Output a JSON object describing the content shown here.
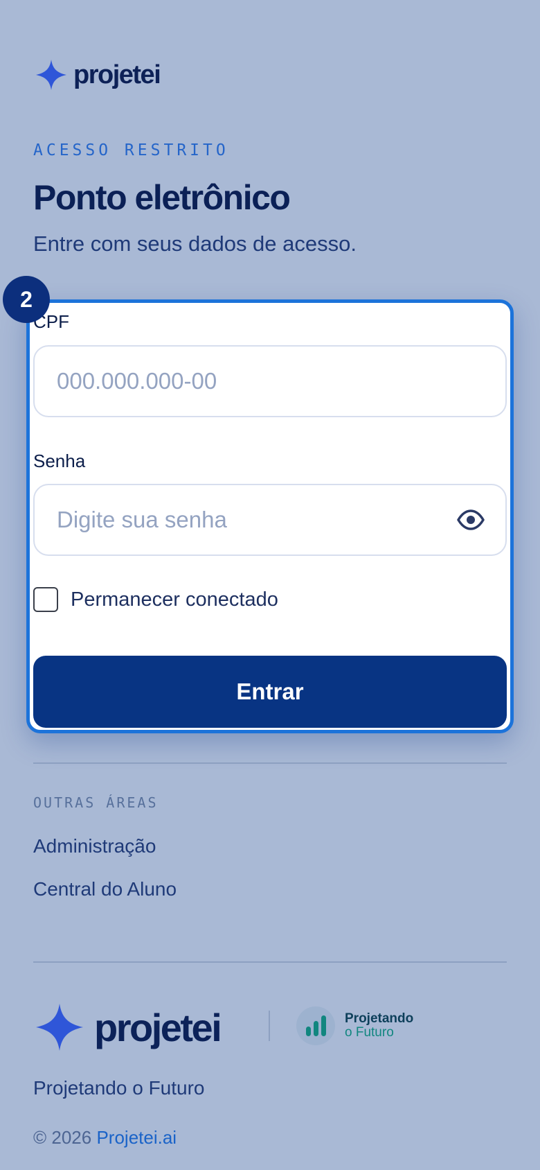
{
  "header": {
    "brand_name": "projetei",
    "logo_icon": "sparkle-star-icon"
  },
  "intro": {
    "eyebrow": "ACESSO RESTRITO",
    "title": "Ponto eletrônico",
    "subtitle": "Entre com seus dados de acesso."
  },
  "step_badge": "2",
  "form": {
    "cpf_label": "CPF",
    "cpf_placeholder": "000.000.000-00",
    "password_label": "Senha",
    "password_placeholder": "Digite sua senha",
    "password_toggle_icon": "eye-icon",
    "remember_label": "Permanecer conectado",
    "remember_checked": false,
    "submit_label": "Entrar"
  },
  "other_areas": {
    "label": "OUTRAS ÁREAS",
    "links": [
      "Administração",
      "Central do Aluno"
    ]
  },
  "footer": {
    "brand_name": "projetei",
    "partner_name": "Projetando",
    "partner_tagline": "o Futuro",
    "tagline": "Projetando o Futuro",
    "copyright_prefix": "© 2026",
    "copyright_link": "Projetei.ai"
  },
  "colors": {
    "background": "#a9b9d5",
    "primary": "#083483",
    "accent": "#1c73da",
    "partner_teal": "#11867f"
  }
}
